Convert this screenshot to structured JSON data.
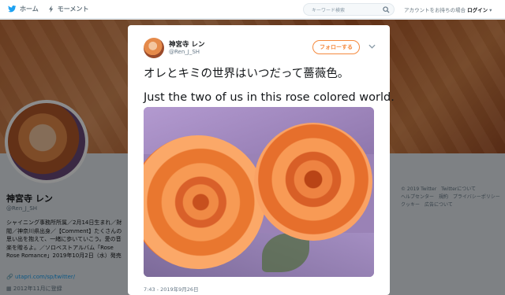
{
  "nav": {
    "home_label": "ホーム",
    "moments_label": "モーメント",
    "search_placeholder": "キーワード検索",
    "account_prompt": "アカウントをお持ちの場合",
    "login_label": "ログイン"
  },
  "profile": {
    "name": "神宮寺 レン",
    "handle": "@Ren_J_SH",
    "bio": "シャイニング事務所所属／2月14日生まれ／財閥／神奈川県出身／【Comment】たくさんの思い出を抱えて、一緒に歩いていこう。愛の音楽を贈るよ。／ソロベストアルバム「Rose Rose Romance」2019年10月2日（水）発売",
    "link": "utapri.com/sp/twitter/",
    "joined": "2012年11月に登録"
  },
  "footer": {
    "links": [
      "© 2019 Twitter",
      "Twitterについて",
      "ヘルプセンター",
      "規約",
      "プライバシーポリシー",
      "クッキー",
      "広告について"
    ]
  },
  "tweet": {
    "name": "神宮寺 レン",
    "handle": "@Ren_J_SH",
    "follow_label": "フォローする",
    "text_jp": "オレとキミの世界はいつだって薔薇色。",
    "text_en": "Just the two of us in this rose colored world.",
    "timestamp": "7:43 - 2019年9月26日"
  },
  "colors": {
    "accent": "#f58a3e",
    "link": "#1da1f2"
  }
}
